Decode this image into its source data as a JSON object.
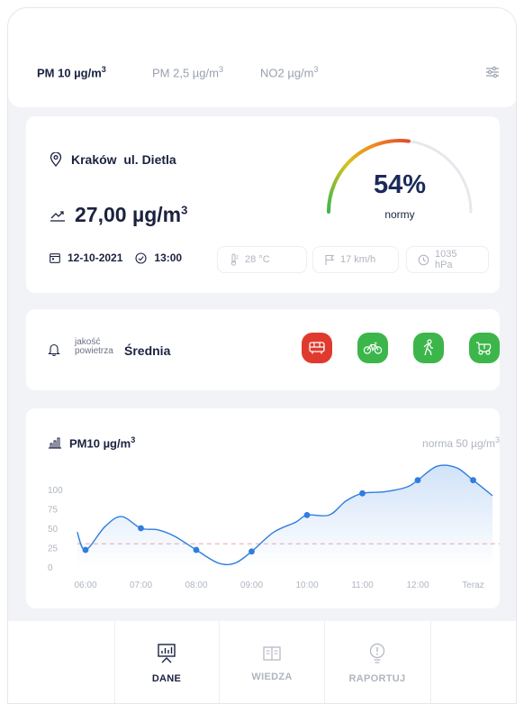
{
  "tabs": [
    {
      "label": "PM 10 µg/m",
      "sup": "3",
      "active": true
    },
    {
      "label": "PM 2,5 µg/m",
      "sup": "3",
      "active": false
    },
    {
      "label": "NO2 µg/m",
      "sup": "3",
      "active": false
    }
  ],
  "location": {
    "name": "Kraków  ul. Dietla",
    "value": "27,00 µg/m",
    "value_sup": "3",
    "date": "12-10-2021",
    "time": "13:00",
    "temperature": "28 °C",
    "wind": "17 km/h",
    "pressure": "1035 hPa",
    "gauge_percent": "54%",
    "gauge_label": "normy",
    "gauge_fraction": 0.54
  },
  "quality": {
    "label_line1": "jakość",
    "label_line2": "powietrza",
    "value": "Średnia",
    "activities": [
      {
        "icon": "bus-icon",
        "color": "#e03a2f"
      },
      {
        "icon": "bicycle-icon",
        "color": "#3cb64a"
      },
      {
        "icon": "walking-icon",
        "color": "#3cb64a"
      },
      {
        "icon": "stroller-icon",
        "color": "#3cb64a"
      }
    ]
  },
  "chart": {
    "title": "PM10 µg/m",
    "title_sup": "3",
    "norm_label": "norma 50 µg/m",
    "norm_sup": "3"
  },
  "chart_data": {
    "type": "line",
    "x": [
      "06:00",
      "07:00",
      "08:00",
      "09:00",
      "10:00",
      "11:00",
      "12:00",
      "Teraz"
    ],
    "y_ticks": [
      0,
      25,
      50,
      75,
      100
    ],
    "ylim": [
      0,
      100
    ],
    "norm": 30,
    "series": [
      {
        "points": [
          [
            -0.15,
            45
          ],
          [
            0,
            22
          ],
          [
            0.35,
            52
          ],
          [
            0.65,
            65
          ],
          [
            1,
            50
          ],
          [
            1.3,
            48
          ],
          [
            1.6,
            40
          ],
          [
            2,
            22
          ],
          [
            2.4,
            5
          ],
          [
            2.7,
            5
          ],
          [
            3,
            20
          ],
          [
            3.4,
            45
          ],
          [
            3.8,
            58
          ],
          [
            4,
            67
          ],
          [
            4.4,
            67
          ],
          [
            4.7,
            85
          ],
          [
            5,
            95
          ],
          [
            5.4,
            97
          ],
          [
            5.8,
            103
          ],
          [
            6,
            112
          ],
          [
            6.35,
            130
          ],
          [
            6.7,
            128
          ],
          [
            7,
            112
          ],
          [
            7.35,
            92
          ]
        ]
      }
    ],
    "markers": [
      [
        0,
        22
      ],
      [
        1,
        50
      ],
      [
        2,
        22
      ],
      [
        3,
        20
      ],
      [
        4,
        67
      ],
      [
        5,
        95
      ],
      [
        6,
        112
      ],
      [
        7,
        112
      ]
    ]
  },
  "nav": [
    {
      "label": "DANE",
      "icon": "presentation-chart-icon",
      "active": true
    },
    {
      "label": "WIEDZA",
      "icon": "book-icon",
      "active": false
    },
    {
      "label": "RAPORTUJ",
      "icon": "lightbulb-alert-icon",
      "active": false
    }
  ]
}
